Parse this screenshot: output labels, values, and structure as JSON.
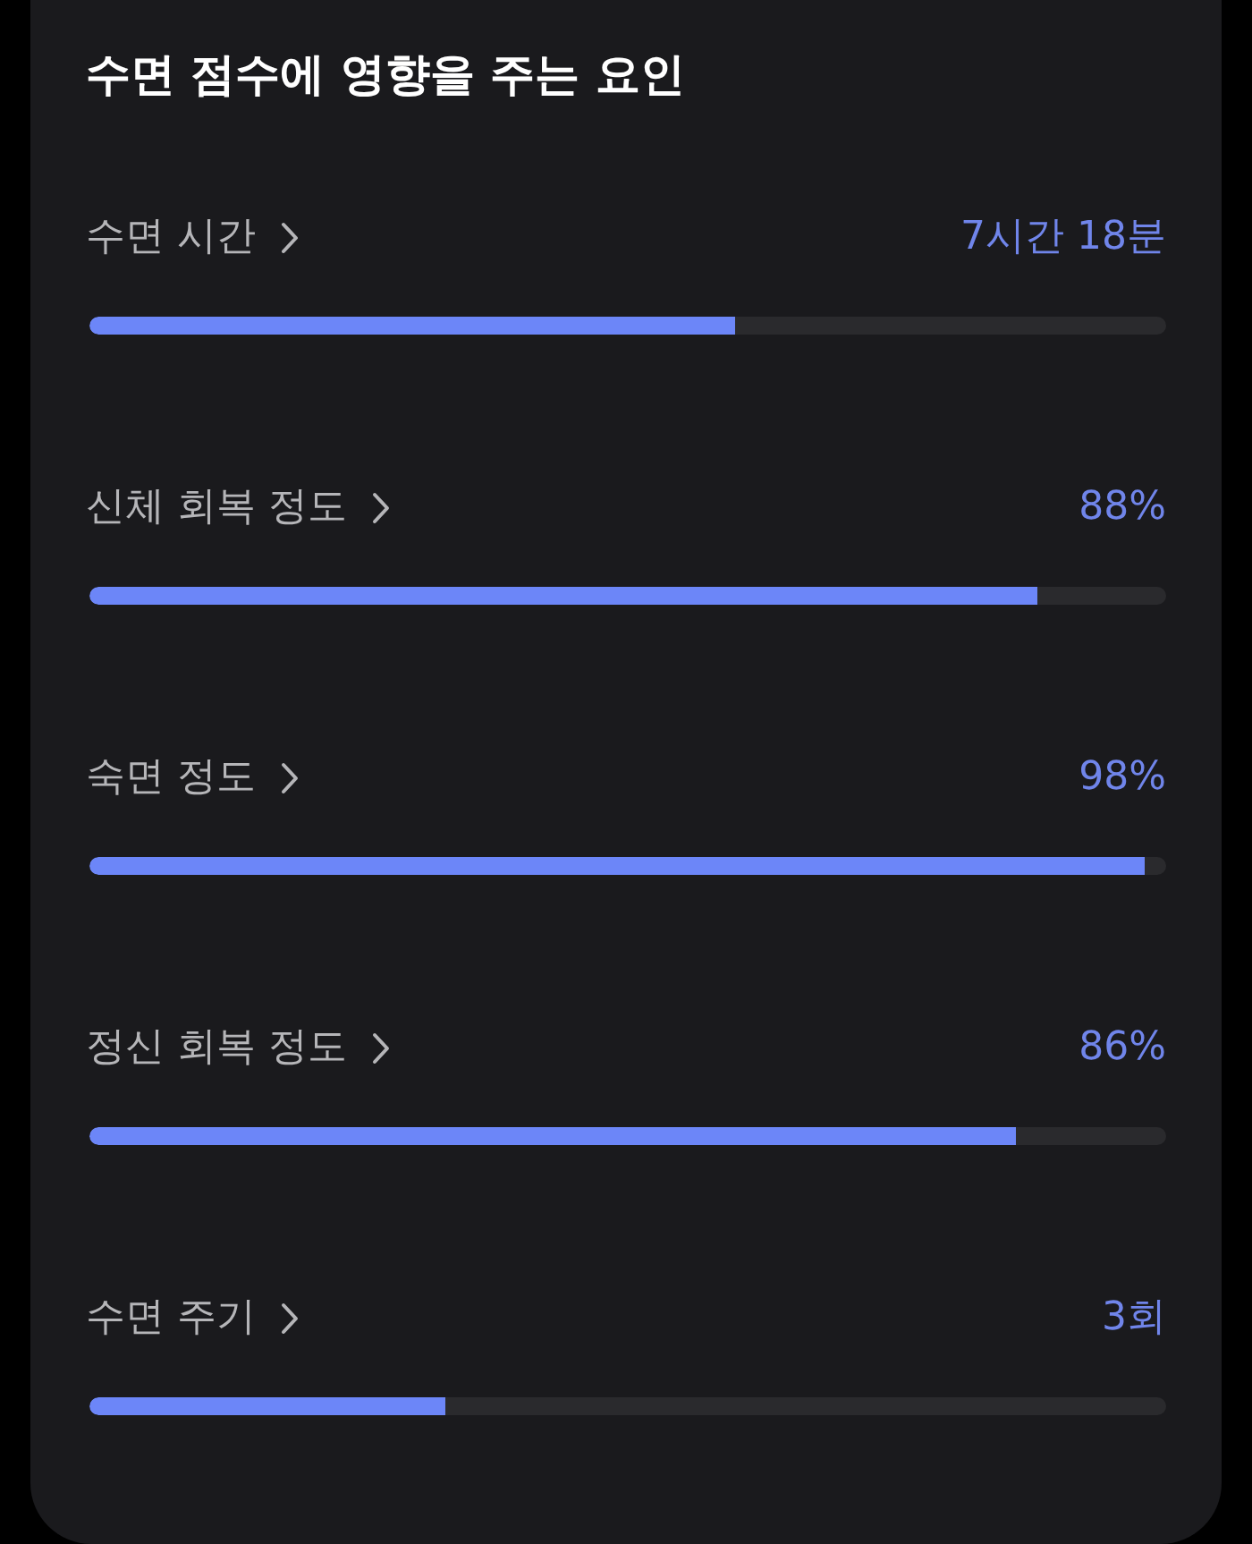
{
  "title": "수면 점수에 영향을 주는 요인",
  "factors": [
    {
      "label": "수면 시간",
      "value": "7시간 18분",
      "level": 0.6
    },
    {
      "label": "신체 회복 정도",
      "value": "88%",
      "level": 0.88
    },
    {
      "label": "숙면 정도",
      "value": "98%",
      "level": 0.98
    },
    {
      "label": "정신 회복 정도",
      "value": "86%",
      "level": 0.86
    },
    {
      "label": "수면 주기",
      "value": "3회",
      "level": 0.33
    }
  ]
}
